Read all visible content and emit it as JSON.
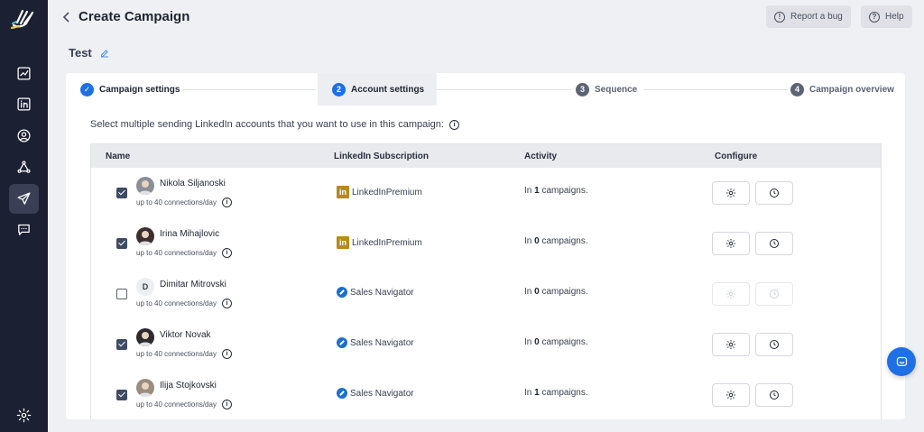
{
  "header": {
    "title": "Create Campaign",
    "report_bug": "Report a bug",
    "help": "Help"
  },
  "campaign": {
    "name": "Test"
  },
  "steps": [
    {
      "num": "1",
      "label": "Campaign settings",
      "state": "done"
    },
    {
      "num": "2",
      "label": "Account settings",
      "state": "current"
    },
    {
      "num": "3",
      "label": "Sequence",
      "state": "todo"
    },
    {
      "num": "4",
      "label": "Campaign overview",
      "state": "todo"
    }
  ],
  "instruction": "Select multiple sending LinkedIn accounts that you want to use in this campaign:",
  "table": {
    "headers": {
      "name": "Name",
      "subscription": "LinkedIn Subscription",
      "activity": "Activity",
      "configure": "Configure"
    },
    "rows": [
      {
        "name": "Nikola Siljanoski",
        "limit": "up to 40 connections/day",
        "subscription": "LinkedInPremium",
        "sub_type": "premium",
        "activity_prefix": "In",
        "activity_count": "1",
        "activity_suffix": "campaigns.",
        "checked": true,
        "avatar": "photo"
      },
      {
        "name": "Irina Mihajlovic",
        "limit": "up to 40 connections/day",
        "subscription": "LinkedInPremium",
        "sub_type": "premium",
        "activity_prefix": "In",
        "activity_count": "0",
        "activity_suffix": "campaigns.",
        "checked": true,
        "avatar": "photo"
      },
      {
        "name": "Dimitar Mitrovski",
        "limit": "up to 40 connections/day",
        "subscription": "Sales Navigator",
        "sub_type": "navigator",
        "activity_prefix": "In",
        "activity_count": "0",
        "activity_suffix": "campaigns.",
        "checked": false,
        "avatar": "D"
      },
      {
        "name": "Viktor Novak",
        "limit": "up to 40 connections/day",
        "subscription": "Sales Navigator",
        "sub_type": "navigator",
        "activity_prefix": "In",
        "activity_count": "0",
        "activity_suffix": "campaigns.",
        "checked": true,
        "avatar": "photo"
      },
      {
        "name": "Ilija Stojkovski",
        "limit": "up to 40 connections/day",
        "subscription": "Sales Navigator",
        "sub_type": "navigator",
        "activity_prefix": "In",
        "activity_count": "1",
        "activity_suffix": "campaigns.",
        "checked": true,
        "avatar": "photo"
      }
    ]
  },
  "colors": {
    "sidebar": "#1c2033",
    "accent": "#1f6fe5",
    "premium": "#b88a1b",
    "navigator": "#1a6fcf"
  }
}
